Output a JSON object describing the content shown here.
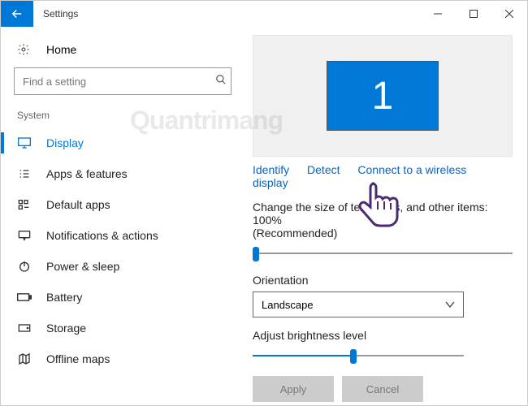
{
  "titlebar": {
    "title": "Settings"
  },
  "home_label": "Home",
  "search": {
    "placeholder": "Find a setting"
  },
  "group_label": "System",
  "nav": [
    {
      "label": "Display",
      "active": true
    },
    {
      "label": "Apps & features"
    },
    {
      "label": "Default apps"
    },
    {
      "label": "Notifications & actions"
    },
    {
      "label": "Power & sleep"
    },
    {
      "label": "Battery"
    },
    {
      "label": "Storage"
    },
    {
      "label": "Offline maps"
    }
  ],
  "monitor_number": "1",
  "links": {
    "identify": "Identify",
    "detect": "Detect",
    "wireless": "Connect to a wireless display"
  },
  "size_label_pre": "Change the size of text, apps, and other items: ",
  "size_value": "100%",
  "size_label_suffix": "(Recommended)",
  "orientation_label": "Orientation",
  "orientation_value": "Landscape",
  "brightness_label": "Adjust brightness level",
  "apply_label": "Apply",
  "cancel_label": "Cancel",
  "watermark": "Quantrimang"
}
